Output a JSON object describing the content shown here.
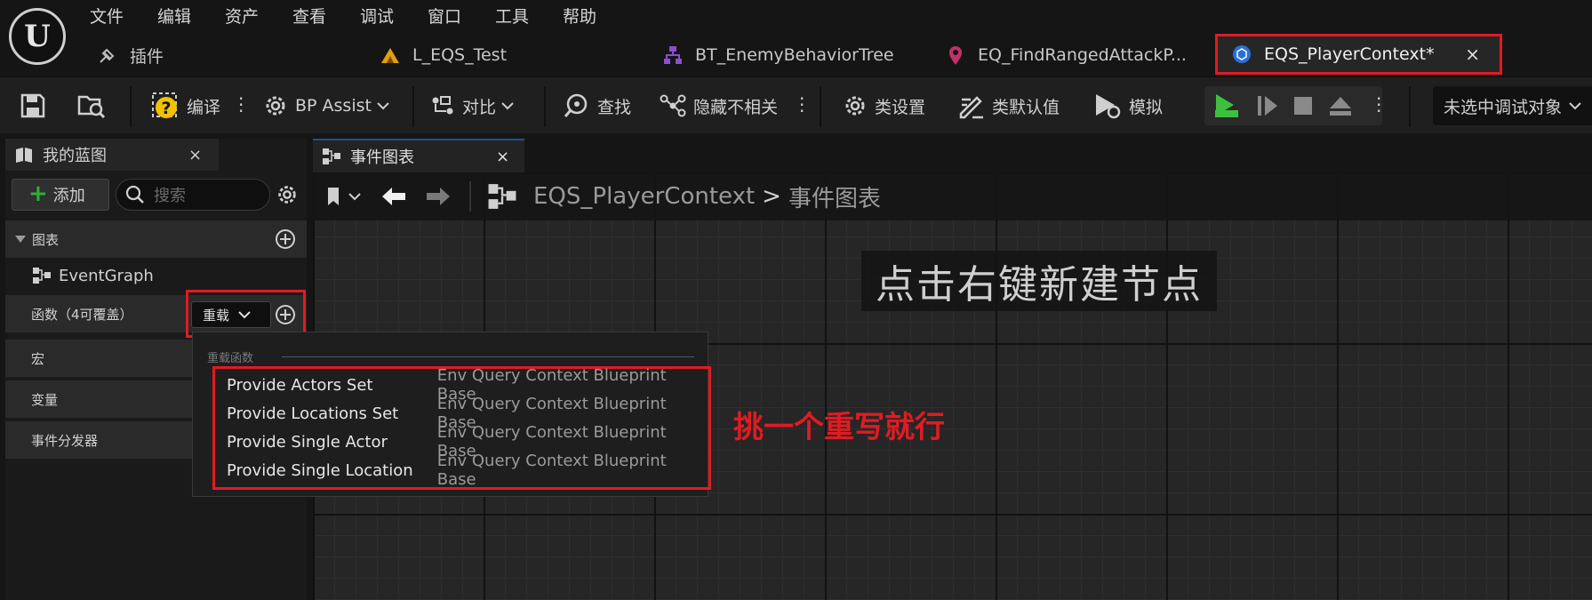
{
  "menu": [
    "文件",
    "编辑",
    "资产",
    "查看",
    "调试",
    "窗口",
    "工具",
    "帮助"
  ],
  "logo": "U",
  "doc_tabs": [
    {
      "label": "插件",
      "icon": "plugin-icon"
    },
    {
      "label": "L_EQS_Test",
      "icon": "level-icon"
    },
    {
      "label": "BT_EnemyBehaviorTree",
      "icon": "behavior-tree-icon"
    },
    {
      "label": "EQ_FindRangedAttackP...",
      "icon": "env-query-icon"
    },
    {
      "label": "EQS_PlayerContext*",
      "icon": "blueprint-icon",
      "close": "×"
    }
  ],
  "toolbar": {
    "compile": "编译",
    "bp_assist": "BP Assist",
    "diff": "对比",
    "find": "查找",
    "hide_unrelated": "隐藏不相关",
    "class_settings": "类设置",
    "class_defaults": "类默认值",
    "simulate": "模拟",
    "debug_target": "未选中调试对象"
  },
  "my_blueprint": {
    "tab_label": "我的蓝图",
    "close": "×",
    "add_label": "添加",
    "search_placeholder": "搜索",
    "graphs_label": "图表",
    "event_graph": "EventGraph",
    "functions_label": "函数（4可覆盖）",
    "override_label": "重载",
    "macros_label": "宏",
    "variables_label": "变量",
    "dispatchers_label": "事件分发器"
  },
  "graph": {
    "tab_label": "事件图表",
    "close": "×",
    "breadcrumb_root": "EQS_PlayerContext",
    "breadcrumb_sep": ">",
    "breadcrumb_leaf": "事件图表",
    "hint": "点击右键新建节点"
  },
  "override_popup": {
    "header": "重载函数",
    "items": [
      {
        "name": "Provide Actors Set",
        "class": "Env Query Context Blueprint Base"
      },
      {
        "name": "Provide Locations Set",
        "class": "Env Query Context Blueprint Base"
      },
      {
        "name": "Provide Single Actor",
        "class": "Env Query Context Blueprint Base"
      },
      {
        "name": "Provide Single Location",
        "class": "Env Query Context Blueprint Base"
      }
    ]
  },
  "annotation": "挑一个重写就行",
  "colors": {
    "accent_red": "#e11b22",
    "play_green": "#3fbf3f",
    "add_green": "#2fae3a"
  }
}
